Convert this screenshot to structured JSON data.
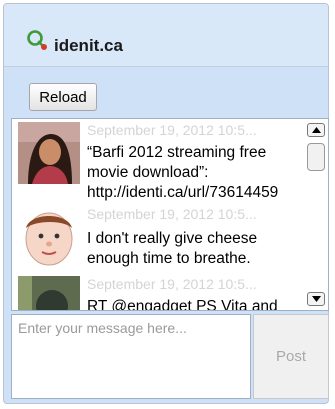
{
  "header": {
    "site_name": "idenit.ca",
    "logo_icon": "identica-logo-icon",
    "accent": "#4caf50"
  },
  "toolbar": {
    "reload_label": "Reload"
  },
  "timeline": {
    "posts": [
      {
        "timestamp": "September 19, 2012 10:5...",
        "text": "“Barfi 2012 streaming free movie download”: http://identi.ca/url/73614459"
      },
      {
        "timestamp": "September 19, 2012 10:5...",
        "text": "I don't really give cheese enough time to breathe."
      },
      {
        "timestamp": "September 19, 2012 10:5...",
        "text": "RT @engadget PS Vita and"
      }
    ]
  },
  "compose": {
    "placeholder": "Enter your message here...",
    "post_label": "Post"
  }
}
